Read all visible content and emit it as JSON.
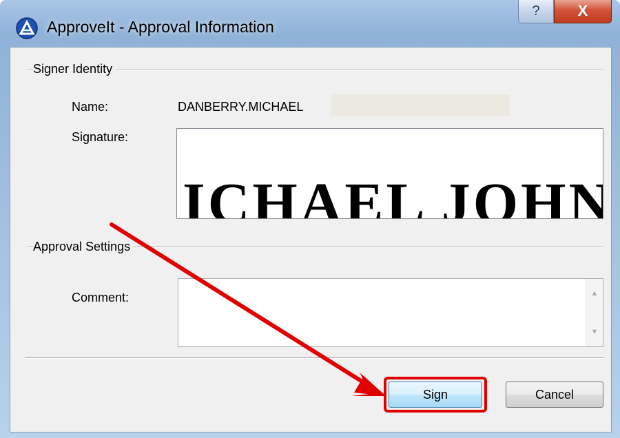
{
  "window": {
    "title": "ApproveIt - Approval Information",
    "help_label": "?",
    "close_label": "X"
  },
  "signer_identity": {
    "group_title": "Signer Identity",
    "name_label": "Name:",
    "name_value": "DANBERRY.MICHAEL",
    "signature_label": "Signature:",
    "signature_text": "ICHAEL JOHN"
  },
  "approval_settings": {
    "group_title": "Approval Settings",
    "comment_label": "Comment:",
    "comment_value": ""
  },
  "buttons": {
    "sign_label": "Sign",
    "cancel_label": "Cancel"
  },
  "annotation": {
    "color": "#e00000"
  },
  "colors": {
    "dialog_bg": "#f0f0f0",
    "close_button": "#c8432a"
  }
}
